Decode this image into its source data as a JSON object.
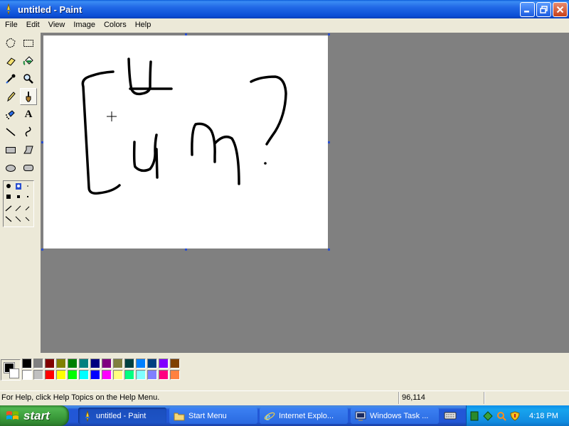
{
  "window": {
    "title": "untitled - Paint"
  },
  "menu": {
    "items": [
      {
        "label": "File"
      },
      {
        "label": "Edit"
      },
      {
        "label": "View"
      },
      {
        "label": "Image"
      },
      {
        "label": "Colors"
      },
      {
        "label": "Help"
      }
    ]
  },
  "toolbox": {
    "tools": [
      {
        "name": "free-form-select",
        "icon": "free-select-icon"
      },
      {
        "name": "select",
        "icon": "rect-select-icon"
      },
      {
        "name": "eraser",
        "icon": "eraser-icon"
      },
      {
        "name": "fill",
        "icon": "fill-bucket-icon"
      },
      {
        "name": "pick-color",
        "icon": "eyedropper-icon"
      },
      {
        "name": "magnifier",
        "icon": "magnifier-icon"
      },
      {
        "name": "pencil",
        "icon": "pencil-icon"
      },
      {
        "name": "brush",
        "icon": "brush-icon",
        "active": true
      },
      {
        "name": "airbrush",
        "icon": "airbrush-icon"
      },
      {
        "name": "text",
        "icon": "text-icon"
      },
      {
        "name": "line",
        "icon": "line-icon"
      },
      {
        "name": "curve",
        "icon": "curve-icon"
      },
      {
        "name": "rectangle",
        "icon": "rectangle-icon"
      },
      {
        "name": "polygon",
        "icon": "polygon-icon"
      },
      {
        "name": "ellipse",
        "icon": "ellipse-icon"
      },
      {
        "name": "rounded-rectangle",
        "icon": "rounded-rect-icon"
      }
    ],
    "text_tool_glyph": "A"
  },
  "colors": {
    "foreground": "#000000",
    "background": "#ffffff",
    "palette_top": [
      "#000000",
      "#808080",
      "#800000",
      "#808000",
      "#008000",
      "#008080",
      "#000080",
      "#800080",
      "#808040",
      "#004040",
      "#0080ff",
      "#004080",
      "#8000ff",
      "#804000"
    ],
    "palette_bottom": [
      "#ffffff",
      "#c0c0c0",
      "#ff0000",
      "#ffff00",
      "#00ff00",
      "#00ffff",
      "#0000ff",
      "#ff00ff",
      "#ffff80",
      "#00ff80",
      "#80ffff",
      "#8080ff",
      "#ff0080",
      "#ff8040"
    ]
  },
  "status": {
    "help_text": "For Help, click Help Topics on the Help Menu.",
    "coordinates": "96,114"
  },
  "taskbar": {
    "start_label": "start",
    "buttons": [
      {
        "label": "untitled - Paint",
        "icon": "paint-icon",
        "active": true
      },
      {
        "label": "Start Menu",
        "icon": "folder-icon",
        "active": false
      },
      {
        "label": "Internet Explo...",
        "icon": "ie-icon",
        "active": false
      },
      {
        "label": "Windows Task ...",
        "icon": "task-manager-icon",
        "active": false
      }
    ],
    "clock": "4:18 PM"
  }
}
